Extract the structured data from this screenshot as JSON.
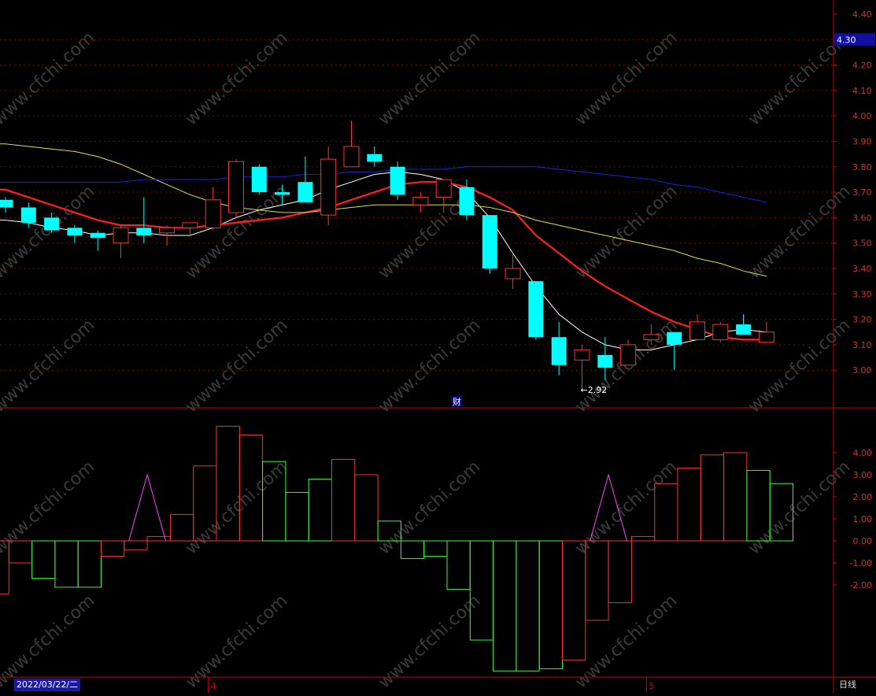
{
  "chart_data": {
    "type": "candlestick",
    "watermark": "www.cfchi.com",
    "price_panel": {
      "yticks": [
        "4.40",
        "4.30",
        "4.20",
        "4.10",
        "4.00",
        "3.90",
        "3.80",
        "3.70",
        "3.60",
        "3.50",
        "3.40",
        "3.30",
        "3.20",
        "3.10",
        "3.00"
      ],
      "ylim": [
        2.86,
        4.45
      ],
      "current_price_label": "4.30",
      "low_annotation": "←2.92",
      "marker_label": "财",
      "candles": [
        {
          "o": 3.67,
          "h": 3.68,
          "l": 3.62,
          "c": 3.64
        },
        {
          "o": 3.64,
          "h": 3.66,
          "l": 3.56,
          "c": 3.58
        },
        {
          "o": 3.6,
          "h": 3.62,
          "l": 3.54,
          "c": 3.55
        },
        {
          "o": 3.56,
          "h": 3.57,
          "l": 3.5,
          "c": 3.53
        },
        {
          "o": 3.54,
          "h": 3.55,
          "l": 3.47,
          "c": 3.52
        },
        {
          "o": 3.5,
          "h": 3.57,
          "l": 3.44,
          "c": 3.56
        },
        {
          "o": 3.56,
          "h": 3.68,
          "l": 3.5,
          "c": 3.53
        },
        {
          "o": 3.54,
          "h": 3.57,
          "l": 3.49,
          "c": 3.56
        },
        {
          "o": 3.56,
          "h": 3.58,
          "l": 3.53,
          "c": 3.58
        },
        {
          "o": 3.56,
          "h": 3.72,
          "l": 3.55,
          "c": 3.67
        },
        {
          "o": 3.62,
          "h": 3.83,
          "l": 3.6,
          "c": 3.82
        },
        {
          "o": 3.8,
          "h": 3.81,
          "l": 3.69,
          "c": 3.7
        },
        {
          "o": 3.7,
          "h": 3.73,
          "l": 3.65,
          "c": 3.69
        },
        {
          "o": 3.74,
          "h": 3.84,
          "l": 3.66,
          "c": 3.66
        },
        {
          "o": 3.61,
          "h": 3.88,
          "l": 3.57,
          "c": 3.83
        },
        {
          "o": 3.8,
          "h": 3.98,
          "l": 3.8,
          "c": 3.88
        },
        {
          "o": 3.85,
          "h": 3.88,
          "l": 3.8,
          "c": 3.82
        },
        {
          "o": 3.8,
          "h": 3.82,
          "l": 3.67,
          "c": 3.69
        },
        {
          "o": 3.65,
          "h": 3.7,
          "l": 3.62,
          "c": 3.68
        },
        {
          "o": 3.68,
          "h": 3.74,
          "l": 3.62,
          "c": 3.75
        },
        {
          "o": 3.72,
          "h": 3.75,
          "l": 3.59,
          "c": 3.61
        },
        {
          "o": 3.61,
          "h": 3.61,
          "l": 3.38,
          "c": 3.4
        },
        {
          "o": 3.36,
          "h": 3.46,
          "l": 3.32,
          "c": 3.4
        },
        {
          "o": 3.35,
          "h": 3.35,
          "l": 3.12,
          "c": 3.13
        },
        {
          "o": 3.13,
          "h": 3.19,
          "l": 2.98,
          "c": 3.02
        },
        {
          "o": 3.04,
          "h": 3.1,
          "l": 2.92,
          "c": 3.08
        },
        {
          "o": 3.06,
          "h": 3.13,
          "l": 2.96,
          "c": 3.01
        },
        {
          "o": 3.02,
          "h": 3.12,
          "l": 3.02,
          "c": 3.1
        },
        {
          "o": 3.12,
          "h": 3.18,
          "l": 3.1,
          "c": 3.14
        },
        {
          "o": 3.15,
          "h": 3.15,
          "l": 3.0,
          "c": 3.1
        },
        {
          "o": 3.12,
          "h": 3.22,
          "l": 3.12,
          "c": 3.19
        },
        {
          "o": 3.12,
          "h": 3.19,
          "l": 3.11,
          "c": 3.18
        },
        {
          "o": 3.18,
          "h": 3.22,
          "l": 3.14,
          "c": 3.14
        },
        {
          "o": 3.11,
          "h": 3.19,
          "l": 3.11,
          "c": 3.15
        }
      ],
      "ma_lines": [
        {
          "color": "#ffffff",
          "values": [
            3.59,
            3.58,
            3.56,
            3.55,
            3.53,
            3.54,
            3.54,
            3.53,
            3.53,
            3.56,
            3.6,
            3.63,
            3.65,
            3.67,
            3.71,
            3.74,
            3.77,
            3.78,
            3.77,
            3.75,
            3.7,
            3.6,
            3.46,
            3.33,
            3.22,
            3.15,
            3.1,
            3.08,
            3.08,
            3.1,
            3.12,
            3.15,
            3.16,
            3.15
          ]
        },
        {
          "color": "#ff2020",
          "values": [
            3.71,
            3.68,
            3.65,
            3.62,
            3.59,
            3.57,
            3.57,
            3.56,
            3.56,
            3.57,
            3.58,
            3.59,
            3.6,
            3.62,
            3.64,
            3.67,
            3.7,
            3.73,
            3.74,
            3.74,
            3.72,
            3.68,
            3.63,
            3.53,
            3.46,
            3.39,
            3.33,
            3.28,
            3.23,
            3.19,
            3.16,
            3.13,
            3.12,
            3.12
          ]
        },
        {
          "color": "#e0e040",
          "values": [
            3.89,
            3.88,
            3.87,
            3.86,
            3.84,
            3.81,
            3.77,
            3.73,
            3.69,
            3.66,
            3.64,
            3.63,
            3.62,
            3.62,
            3.63,
            3.64,
            3.65,
            3.65,
            3.65,
            3.65,
            3.65,
            3.64,
            3.62,
            3.59,
            3.57,
            3.55,
            3.53,
            3.51,
            3.49,
            3.47,
            3.44,
            3.42,
            3.39,
            3.37
          ]
        },
        {
          "color": "#2020e0",
          "values": [
            3.74,
            3.74,
            3.74,
            3.74,
            3.74,
            3.74,
            3.75,
            3.75,
            3.75,
            3.75,
            3.76,
            3.76,
            3.76,
            3.77,
            3.77,
            3.78,
            3.78,
            3.79,
            3.79,
            3.79,
            3.8,
            3.8,
            3.8,
            3.8,
            3.79,
            3.78,
            3.77,
            3.76,
            3.75,
            3.73,
            3.72,
            3.7,
            3.68,
            3.66
          ]
        }
      ]
    },
    "indicator_panel": {
      "yticks": [
        "4.00",
        "3.00",
        "2.00",
        "1.00",
        "0.00",
        "-1.00",
        "-2.00"
      ],
      "ylim": [
        -6.2,
        5.3
      ],
      "bars": [
        {
          "v": -2.4,
          "c": "#ff3030"
        },
        {
          "v": -1.0,
          "c": "#ff3030"
        },
        {
          "v": -1.7,
          "c": "#30ff30"
        },
        {
          "v": -2.1,
          "c": "#30ff30"
        },
        {
          "v": -2.1,
          "c": "#30ff30"
        },
        {
          "v": -0.7,
          "c": "#ff3030"
        },
        {
          "v": -0.4,
          "c": "#ff3030"
        },
        {
          "v": 0.2,
          "c": "#ff3030"
        },
        {
          "v": 1.2,
          "c": "#ff3030"
        },
        {
          "v": 3.4,
          "c": "#ff3030"
        },
        {
          "v": 5.2,
          "c": "#ff3030"
        },
        {
          "v": 4.8,
          "c": "#ff3030"
        },
        {
          "v": 3.6,
          "c": "#30ff30"
        },
        {
          "v": 2.2,
          "c": "#30ff30"
        },
        {
          "v": 2.8,
          "c": "#30ff30"
        },
        {
          "v": 3.7,
          "c": "#ff3030"
        },
        {
          "v": 3.0,
          "c": "#ff3030"
        },
        {
          "v": 0.9,
          "c": "#30ff30"
        },
        {
          "v": -0.8,
          "c": "#30ff30"
        },
        {
          "v": -0.7,
          "c": "#30ff30"
        },
        {
          "v": -2.2,
          "c": "#30ff30"
        },
        {
          "v": -4.5,
          "c": "#30ff30"
        },
        {
          "v": -5.9,
          "c": "#30ff30"
        },
        {
          "v": -5.9,
          "c": "#30ff30"
        },
        {
          "v": -5.8,
          "c": "#30ff30"
        },
        {
          "v": -5.4,
          "c": "#ff3030"
        },
        {
          "v": -3.6,
          "c": "#ff3030"
        },
        {
          "v": -2.8,
          "c": "#ff3030"
        },
        {
          "v": 0.2,
          "c": "#ff3030"
        },
        {
          "v": 2.6,
          "c": "#ff3030"
        },
        {
          "v": 3.3,
          "c": "#ff3030"
        },
        {
          "v": 3.9,
          "c": "#ff3030"
        },
        {
          "v": 4.0,
          "c": "#ff3030"
        },
        {
          "v": 3.2,
          "c": "#30ff30"
        },
        {
          "v": 2.6,
          "c": "#30ff30"
        }
      ],
      "triangles": [
        {
          "from": 6,
          "peak": 7,
          "to": 8,
          "v": 3.0
        },
        {
          "from": 26,
          "peak": 27,
          "to": 28,
          "v": 3.0
        }
      ]
    },
    "date_axis": {
      "selected_date": "2022/03/22/二",
      "month_labels": [
        {
          "label": "4",
          "index": 9
        },
        {
          "label": "5",
          "index": 28
        }
      ],
      "period": "日线"
    },
    "colors": {
      "up": "#ff3030",
      "down": "#00ffff",
      "axis": "#cc0000",
      "grid": "#7a0000",
      "triangle": "#ff40ff"
    }
  }
}
